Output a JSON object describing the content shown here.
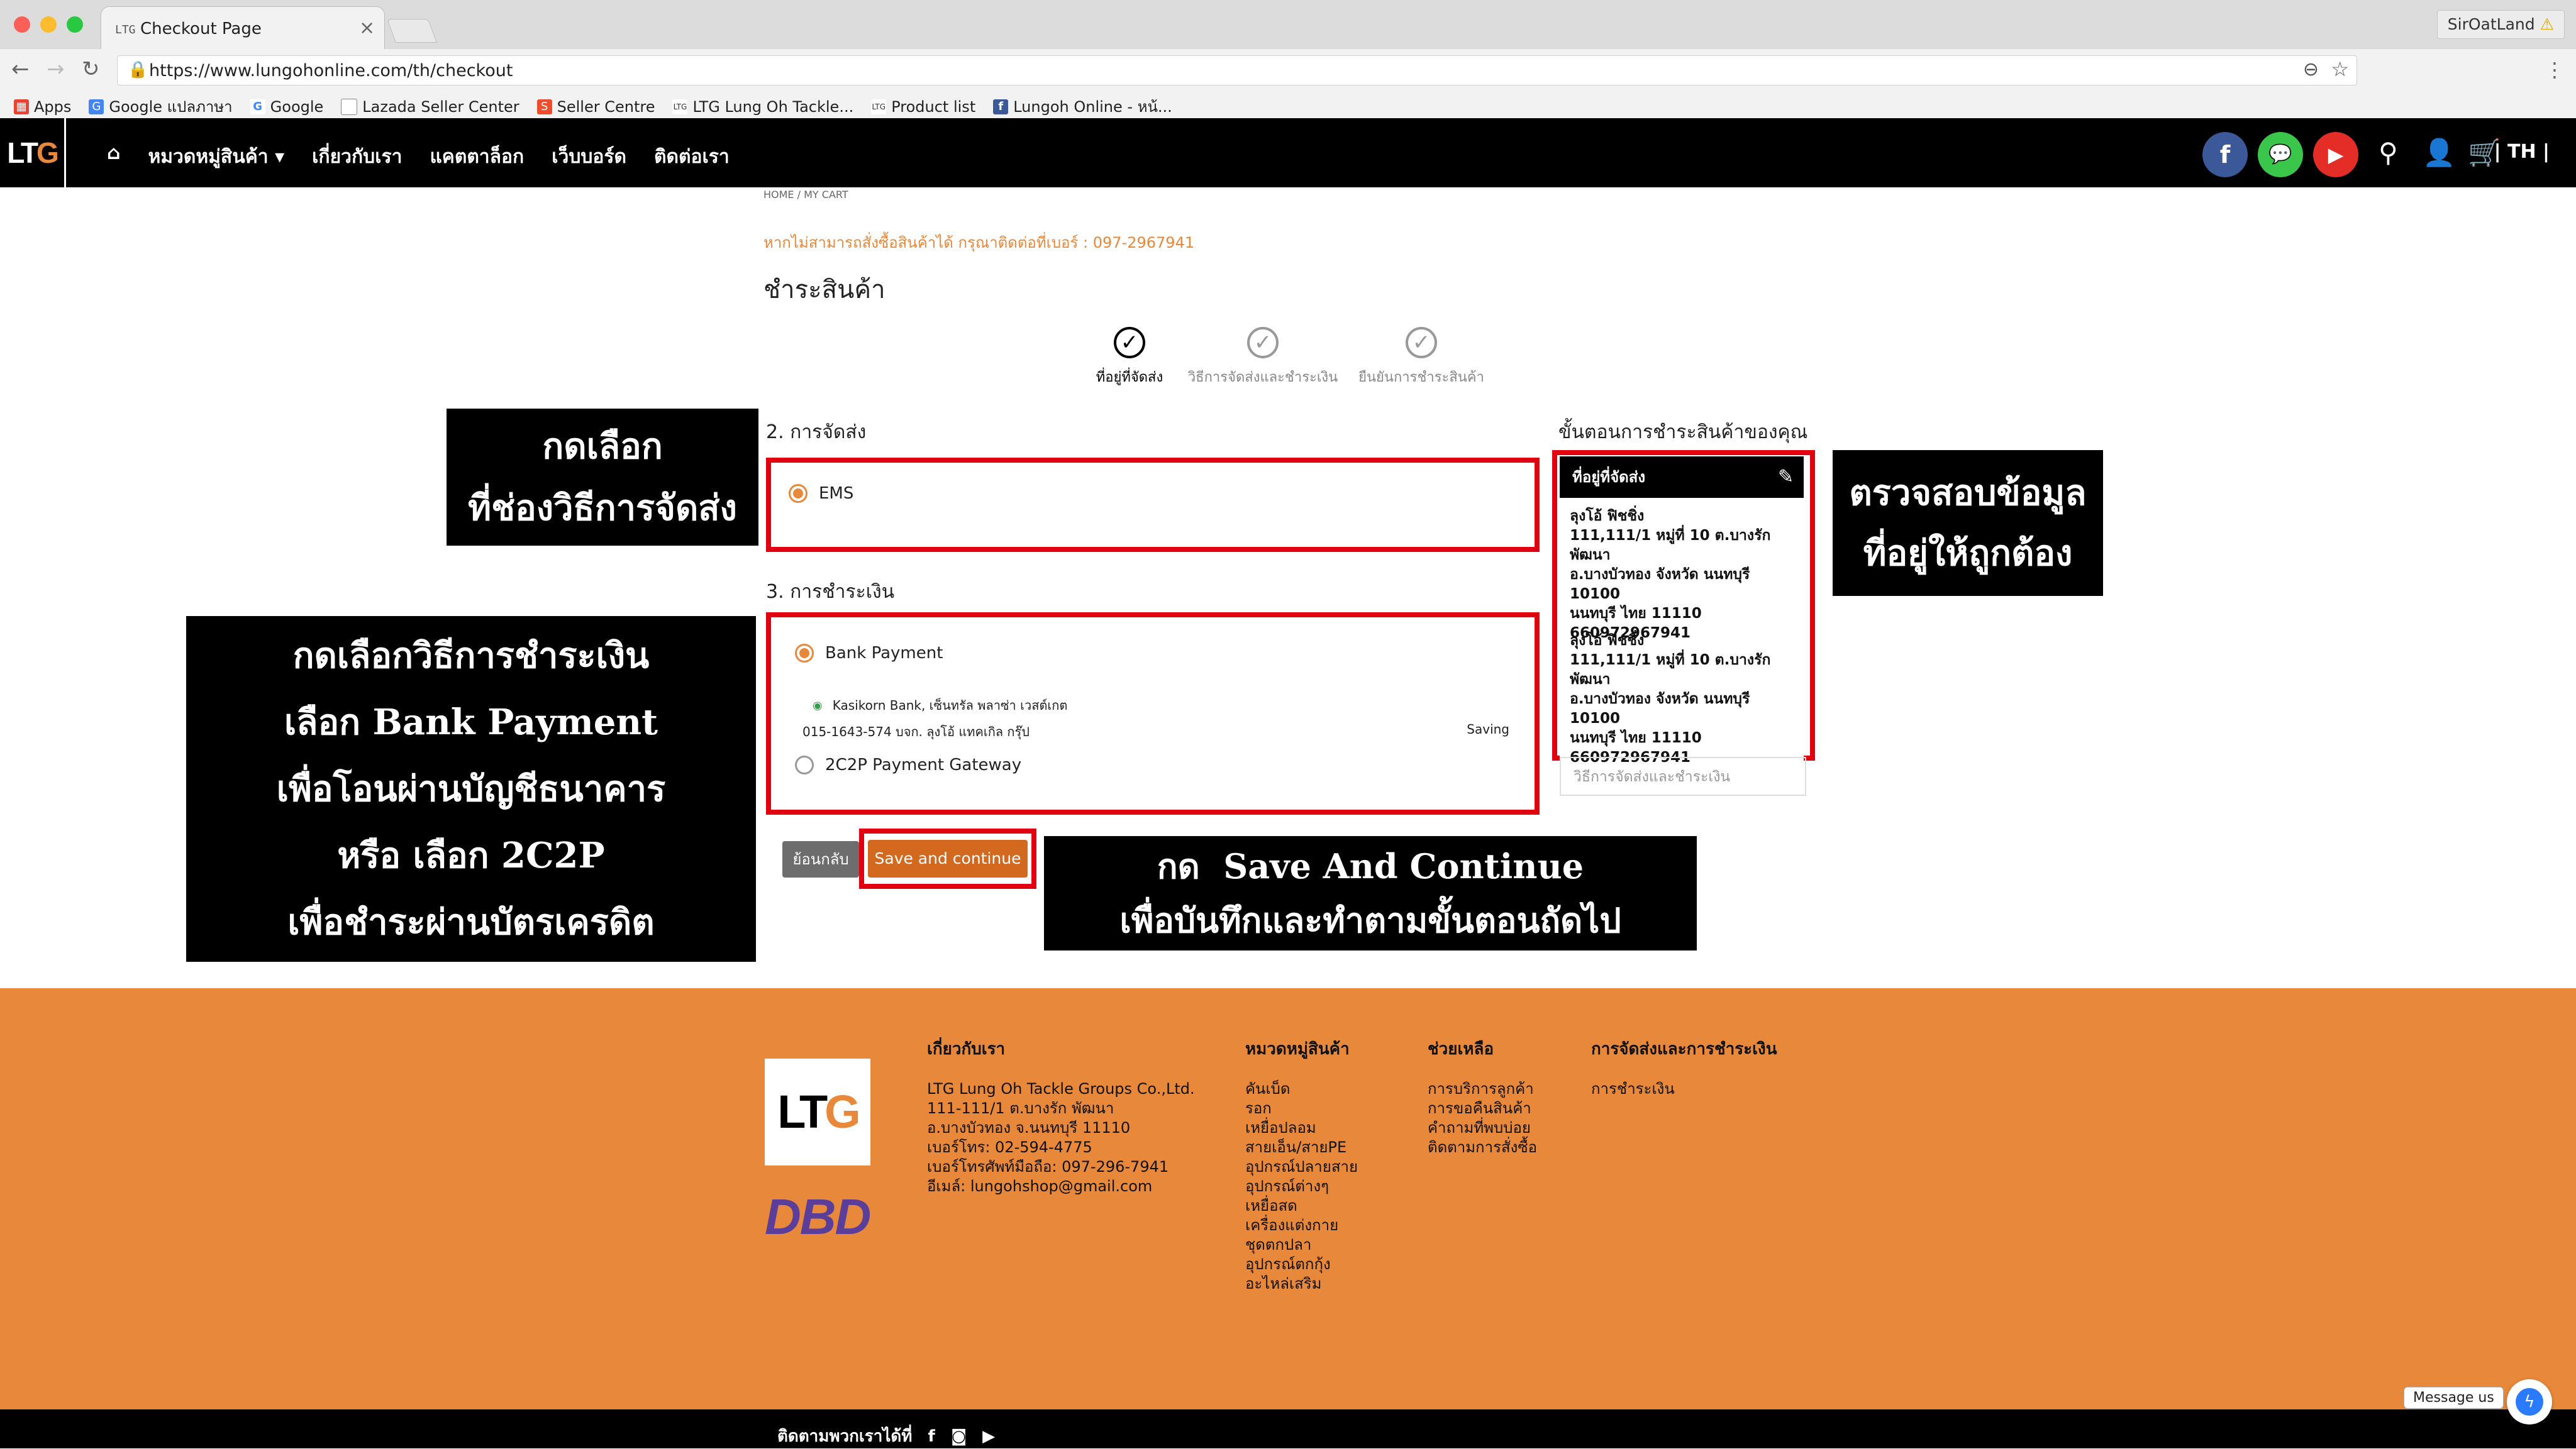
{
  "browser": {
    "tab_title": "Checkout Page",
    "tab_favicon": "LTG",
    "tab_close": "×",
    "profile_name": "SirOatLand",
    "url": "https://www.lungohonline.com/th/checkout",
    "bookmarks": [
      "Apps",
      "Google แปลภาษา",
      "Google",
      "Lazada Seller Center",
      "Seller Centre",
      "LTG Lung Oh Tackle...",
      "Product list",
      "Lungoh Online - หน้..."
    ]
  },
  "site_nav": {
    "logo_lt": "LT",
    "logo_g": "G",
    "items": [
      "หมวดหมู่สินค้า",
      "เกี่ยวกับเรา",
      "แคตตาล็อก",
      "เว็บบอร์ด",
      "ติดต่อเรา"
    ],
    "lang": "TH",
    "social_colors": {
      "facebook": "#3b5998",
      "line": "#3ac64a",
      "youtube": "#e52d27"
    }
  },
  "breadcrumb": {
    "home": "HOME",
    "sep": "/",
    "current": "MY CART"
  },
  "notice": "หากไม่สามารถสั่งซื้อสินค้าได้ กรุณาติดต่อที่เบอร์ : 097-2967941",
  "page_title": "ชำระสินค้า",
  "steps": [
    {
      "label": "ที่อยู่ที่จัดส่ง",
      "active": true
    },
    {
      "label": "วิธีการจัดส่งและชำระเงิน",
      "active": false
    },
    {
      "label": "ยืนยันการชำระสินค้า",
      "active": false
    }
  ],
  "shipping": {
    "heading": "2. การจัดส่ง",
    "option": "EMS"
  },
  "payment": {
    "heading": "3. การชำระเงิน",
    "bank_option": "Bank Payment",
    "bank_name": "Kasikorn Bank, เซ็นทรัล พลาซ่า เวสต์เกต",
    "account": "015-1643-574 บจก. ลุงโอ้ แทคเกิล กรุ๊ป",
    "account_type": "Saving",
    "gateway_option": "2C2P Payment Gateway"
  },
  "buttons": {
    "back": "ย้อนกลับ",
    "save": "Save and continue"
  },
  "summary": {
    "heading": "ขั้นตอนการชำระสินค้าของคุณ",
    "address_title": "ที่อยู่ที่จัดส่ง",
    "addresses": [
      [
        "ลุงโอ้ ฟิชชิ่ง",
        "111,111/1 หมู่ที่ 10 ต.บางรักพัฒนา",
        "อ.บางบัวทอง จังหวัด นนทบุรี",
        "10100",
        "นนทบุรี ไทย 11110",
        "660972967941"
      ],
      [
        "ลุงโอ้ ฟิชชิ่ง",
        "111,111/1 หมู่ที่ 10 ต.บางรักพัฒนา",
        "อ.บางบัวทอง จังหวัด นนทบุรี",
        "10100",
        "นนทบุรี ไทย 11110",
        "660972967941"
      ]
    ],
    "shipping_method_row": "วิธีการจัดส่งและชำระเงิน"
  },
  "annotations": {
    "shipping": [
      "กดเลือก",
      "ที่ช่องวิธีการจัดส่ง"
    ],
    "payment": [
      "กดเลือกวิธีการชำระเงิน",
      "เลือก Bank Payment",
      "เพื่อโอนผ่านบัญชีธนาคาร",
      "หรือ เลือก 2C2P",
      "เพื่อชำระผ่านบัตรเครดิต"
    ],
    "address": [
      "ตรวจสอบข้อมูล",
      "ที่อยู่ให้ถูกต้อง"
    ],
    "save": [
      "กด  Save And Continue",
      "เพื่อบันทึกและทำตามขั้นตอนถัดไป"
    ]
  },
  "footer": {
    "logo_lt": "LT",
    "logo_g": "G",
    "dbd": "DBD",
    "about": {
      "heading": "เกี่ยวกับเรา",
      "lines": [
        "LTG Lung Oh Tackle Groups Co.,Ltd.",
        "111-111/1 ต.บางรัก พัฒนา",
        "อ.บางบัวทอง จ.นนทบุรี 11110",
        "เบอร์โทร: 02-594-4775",
        "เบอร์โทรศัพท์มือถือ: 097-296-7941",
        "อีเมล์: lungohshop@gmail.com"
      ]
    },
    "categories": {
      "heading": "หมวดหมู่สินค้า",
      "lines": [
        "คันเบ็ด",
        "รอก",
        "เหยื่อปลอม",
        "สายเอ็น/สายPE",
        "อุปกรณ์ปลายสาย",
        "อุปกรณ์ต่างๆ",
        "เหยื่อสด",
        "เครื่องแต่งกาย",
        "ชุดตกปลา",
        "อุปกรณ์ตกกุ้ง",
        "อะไหล่เสริม"
      ]
    },
    "help": {
      "heading": "ช่วยเหลือ",
      "lines": [
        "การบริการลูกค้า",
        "การขอคืนสินค้า",
        "คำถามที่พบบ่อย",
        "ติดตามการสั่งซื้อ"
      ]
    },
    "payment": {
      "heading": "การจัดส่งและการชำระเงิน",
      "lines": [
        "การชำระเงิน"
      ]
    },
    "follow": "ติดตามพวกเราได้ที่",
    "brand_color": "#e8883a"
  },
  "messenger": {
    "label": "Message us"
  }
}
